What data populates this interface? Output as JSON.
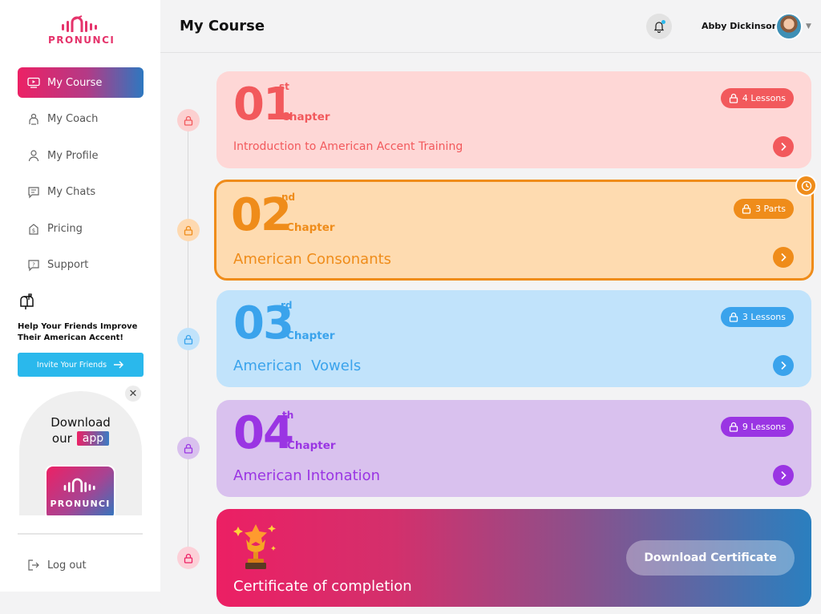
{
  "app": {
    "logo_text": "PRONUNCI"
  },
  "sidebar": {
    "items": [
      {
        "label": "My Course",
        "icon": "play-screen-icon",
        "active": true
      },
      {
        "label": "My Coach",
        "icon": "coach-icon"
      },
      {
        "label": "My Profile",
        "icon": "user-icon"
      },
      {
        "label": "My Chats",
        "icon": "chat-icon"
      },
      {
        "label": "Pricing",
        "icon": "pricing-icon"
      },
      {
        "label": "Support",
        "icon": "support-icon"
      }
    ],
    "invite": {
      "text": "Help Your Friends Improve Their American Accent!",
      "button_label": "Invite Your Friends"
    },
    "app_promo": {
      "line1": "Download",
      "line2": "our",
      "badge": "app",
      "tile_text": "PRONUNCI"
    },
    "logout_label": "Log out"
  },
  "header": {
    "title": "My Course",
    "user_name": "Abby Dickinson"
  },
  "chapters": [
    {
      "number": "01",
      "suffix": "st",
      "chapter_label": "Chapter",
      "badge": "4 Lessons",
      "title": "Introduction to American Accent Training",
      "color": "#f2595c"
    },
    {
      "number": "02",
      "suffix": "nd",
      "chapter_label": "Chapter",
      "badge": "3 Parts",
      "title": "American Consonants",
      "color": "#ef8c1a"
    },
    {
      "number": "03",
      "suffix": "rd",
      "chapter_label": "Chapter",
      "badge": "3 Lessons",
      "title": "American  Vowels",
      "color": "#3aa3ec"
    },
    {
      "number": "04",
      "suffix": "th",
      "chapter_label": "Chapter",
      "badge": "9 Lessons",
      "title": "American Intonation",
      "color": "#9a35e3"
    }
  ],
  "certificate": {
    "title": "Certificate of completion",
    "button_label": "Download Certificate"
  }
}
